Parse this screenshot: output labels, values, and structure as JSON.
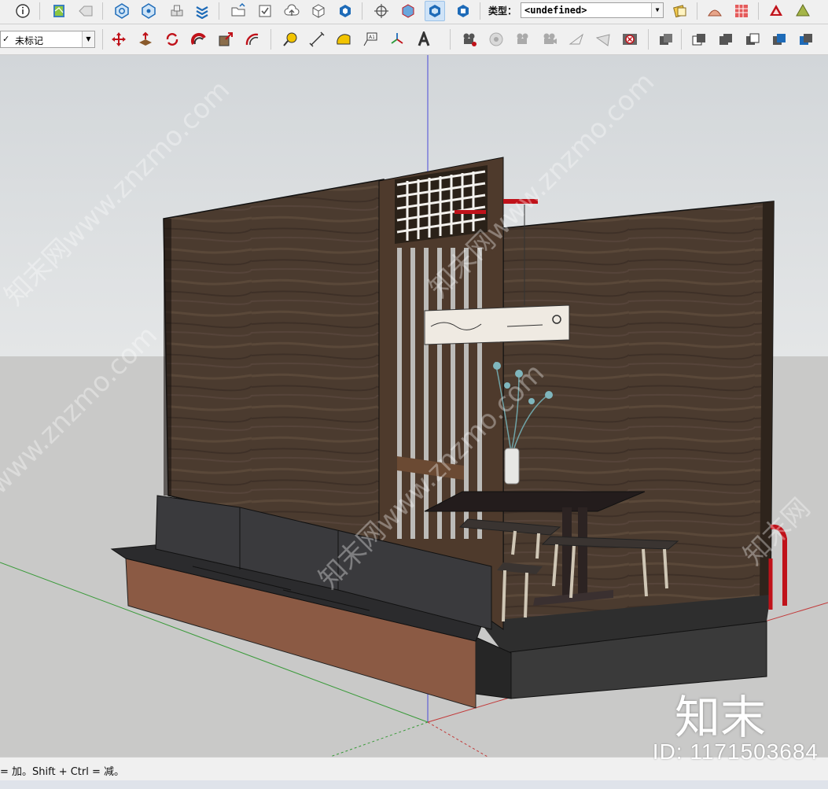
{
  "toolbar_top": {
    "type_label": "类型：",
    "type_value": "<undefined>"
  },
  "toolbar_tags": {
    "current_tag": "未标记"
  },
  "status": {
    "message": "= 加。Shift + Ctrl = 减。"
  },
  "watermark": {
    "id_text": "ID: 1171503684",
    "logo_text": "知末",
    "diagonal_text": "知末网www.znzmo.com"
  },
  "colors": {
    "sky": "#dfe2e4",
    "ground": "#c9c9c8",
    "wood_dark": "#4a3a2e",
    "accent_red": "#c0121a"
  }
}
